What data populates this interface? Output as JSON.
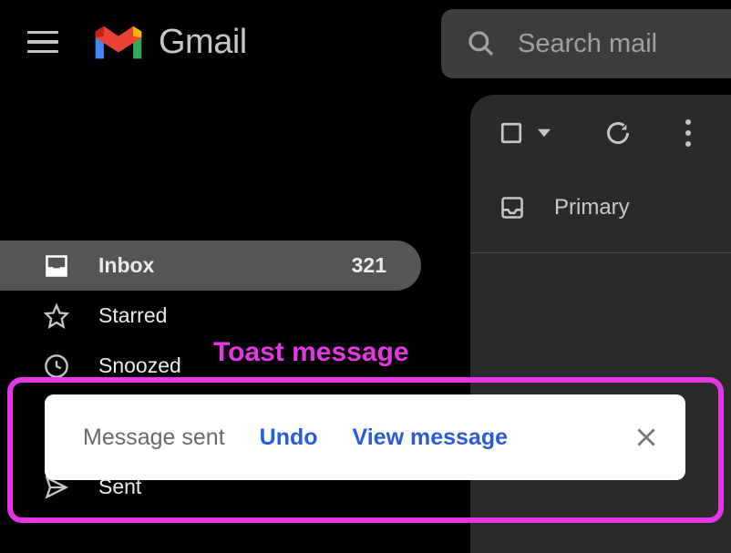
{
  "header": {
    "app_name": "Gmail",
    "search_placeholder": "Search mail"
  },
  "toolbar": {
    "primary_label": "Primary"
  },
  "sidebar": {
    "items": [
      {
        "label": "Inbox",
        "count": "321",
        "active": true
      },
      {
        "label": "Starred",
        "count": "",
        "active": false
      },
      {
        "label": "Snoozed",
        "count": "",
        "active": false
      },
      {
        "label": "Sent",
        "count": "",
        "active": false
      }
    ]
  },
  "toast": {
    "message": "Message sent",
    "undo_label": "Undo",
    "view_label": "View message"
  },
  "annotation": {
    "label": "Toast message"
  }
}
